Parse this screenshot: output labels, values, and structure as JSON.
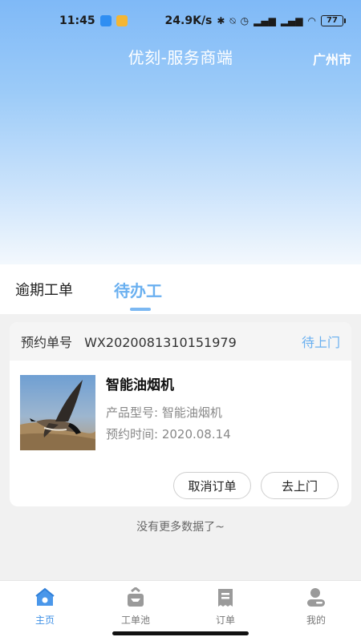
{
  "status_bar": {
    "time": "11:45",
    "network_speed": "24.9K/s",
    "battery": "77",
    "icons": [
      "cloud-app-icon",
      "mail-app-icon",
      "bluetooth-icon",
      "mute-icon",
      "alarm-icon",
      "signal-icon",
      "signal-icon",
      "wifi-icon",
      "battery-icon"
    ]
  },
  "header": {
    "title": "优刻-服务商端",
    "city": "广州市"
  },
  "tabs": [
    {
      "label": "逾期工单",
      "active": false
    },
    {
      "label": "待办工",
      "active": true
    }
  ],
  "order_card": {
    "order_label": "预约单号",
    "order_number": "WX2020081310151979",
    "status": "待上门",
    "product_name": "智能油烟机",
    "model_line": "产品型号: 智能油烟机",
    "time_line": "预约时间: 2020.08.14",
    "cancel_button": "取消订单",
    "go_button": "去上门"
  },
  "no_more_text": "没有更多数据了~",
  "bottom_nav": [
    {
      "label": "主页",
      "icon": "home-icon",
      "active": true
    },
    {
      "label": "工单池",
      "icon": "inbox-icon",
      "active": false
    },
    {
      "label": "订单",
      "icon": "receipt-icon",
      "active": false
    },
    {
      "label": "我的",
      "icon": "profile-icon",
      "active": false
    }
  ],
  "colors": {
    "accent": "#6ab0f0",
    "nav_active": "#3d8fe6",
    "hero_top": "#7fb9f7"
  }
}
